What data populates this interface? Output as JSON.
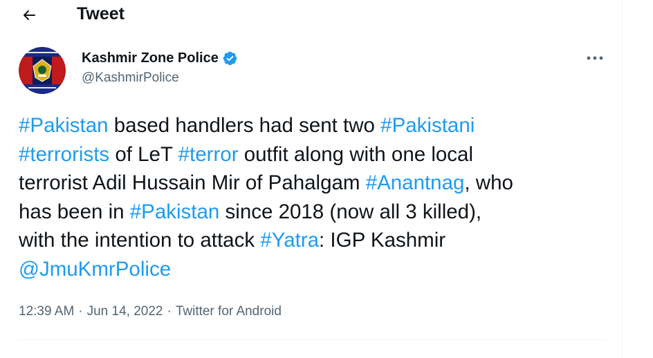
{
  "header": {
    "title": "Tweet",
    "back_icon": "arrow-left-icon"
  },
  "author": {
    "name": "Kashmir Zone Police",
    "handle": "@KashmirPolice",
    "verified": true,
    "verified_color": "#1d9bf0"
  },
  "tweet": {
    "segments": [
      {
        "text": "#Pakistan",
        "type": "hashtag"
      },
      {
        "text": " based handlers had sent two ",
        "type": "text"
      },
      {
        "text": "#Pakistani",
        "type": "hashtag"
      },
      {
        "text": "#terrorists",
        "type": "hashtag"
      },
      {
        "text": " of LeT ",
        "type": "text"
      },
      {
        "text": "#terror",
        "type": "hashtag"
      },
      {
        "text": " outfit along with one local",
        "type": "text"
      },
      {
        "text": "terrorist Adil Hussain Mir of Pahalgam ",
        "type": "text"
      },
      {
        "text": "#Anantnag",
        "type": "hashtag"
      },
      {
        "text": ", who",
        "type": "text"
      },
      {
        "text": "has been in ",
        "type": "text"
      },
      {
        "text": "#Pakistan",
        "type": "hashtag"
      },
      {
        "text": " since 2018 (now all 3 killed),",
        "type": "text"
      },
      {
        "text": "with the intention to attack ",
        "type": "text"
      },
      {
        "text": "#Yatra",
        "type": "hashtag"
      },
      {
        "text": ": IGP Kashmir",
        "type": "text"
      },
      {
        "text": "@JmuKmrPolice",
        "type": "mention"
      }
    ]
  },
  "meta": {
    "time": "12:39 AM",
    "separator": "·",
    "date": "Jun 14, 2022",
    "source": "Twitter for Android"
  },
  "colors": {
    "link": "#1d9bf0",
    "text": "#0f1419",
    "secondary": "#536471"
  }
}
